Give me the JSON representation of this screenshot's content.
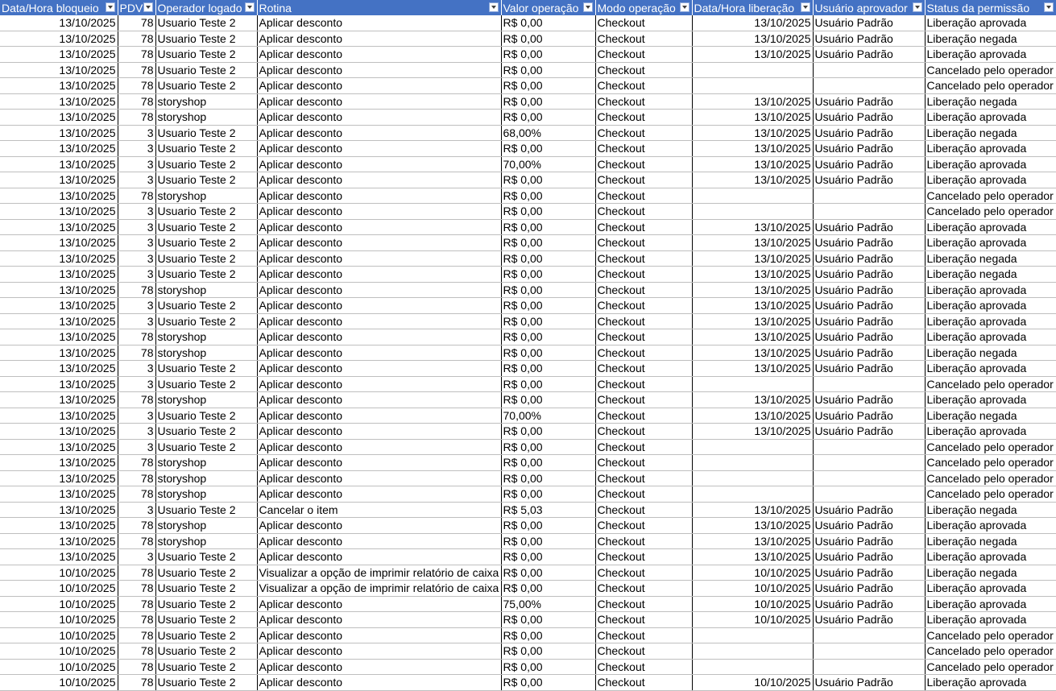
{
  "columns": [
    "Data/Hora bloqueio",
    "PDV",
    "Operador logado",
    "Rotina",
    "Valor operação",
    "Modo operação",
    "Data/Hora liberação",
    "Usuário aprovador",
    "Status da permissão"
  ],
  "rows": [
    [
      "13/10/2025",
      "78",
      "Usuario Teste 2",
      "Aplicar desconto",
      "R$ 0,00",
      "Checkout",
      "13/10/2025",
      "Usuário Padrão",
      "Liberação aprovada"
    ],
    [
      "13/10/2025",
      "78",
      "Usuario Teste 2",
      "Aplicar desconto",
      "R$ 0,00",
      "Checkout",
      "13/10/2025",
      "Usuário Padrão",
      "Liberação negada"
    ],
    [
      "13/10/2025",
      "78",
      "Usuario Teste 2",
      "Aplicar desconto",
      "R$ 0,00",
      "Checkout",
      "13/10/2025",
      "Usuário Padrão",
      "Liberação aprovada"
    ],
    [
      "13/10/2025",
      "78",
      "Usuario Teste 2",
      "Aplicar desconto",
      "R$ 0,00",
      "Checkout",
      "",
      "",
      "Cancelado pelo operador"
    ],
    [
      "13/10/2025",
      "78",
      "Usuario Teste 2",
      "Aplicar desconto",
      "R$ 0,00",
      "Checkout",
      "",
      "",
      "Cancelado pelo operador"
    ],
    [
      "13/10/2025",
      "78",
      "storyshop",
      "Aplicar desconto",
      "R$ 0,00",
      "Checkout",
      "13/10/2025",
      "Usuário Padrão",
      "Liberação negada"
    ],
    [
      "13/10/2025",
      "78",
      "storyshop",
      "Aplicar desconto",
      "R$ 0,00",
      "Checkout",
      "13/10/2025",
      "Usuário Padrão",
      "Liberação aprovada"
    ],
    [
      "13/10/2025",
      "3",
      "Usuario Teste 2",
      "Aplicar desconto",
      "68,00%",
      "Checkout",
      "13/10/2025",
      "Usuário Padrão",
      "Liberação negada"
    ],
    [
      "13/10/2025",
      "3",
      "Usuario Teste 2",
      "Aplicar desconto",
      "R$ 0,00",
      "Checkout",
      "13/10/2025",
      "Usuário Padrão",
      "Liberação aprovada"
    ],
    [
      "13/10/2025",
      "3",
      "Usuario Teste 2",
      "Aplicar desconto",
      "70,00%",
      "Checkout",
      "13/10/2025",
      "Usuário Padrão",
      "Liberação aprovada"
    ],
    [
      "13/10/2025",
      "3",
      "Usuario Teste 2",
      "Aplicar desconto",
      "R$ 0,00",
      "Checkout",
      "13/10/2025",
      "Usuário Padrão",
      "Liberação aprovada"
    ],
    [
      "13/10/2025",
      "78",
      "storyshop",
      "Aplicar desconto",
      "R$ 0,00",
      "Checkout",
      "",
      "",
      "Cancelado pelo operador"
    ],
    [
      "13/10/2025",
      "3",
      "Usuario Teste 2",
      "Aplicar desconto",
      "R$ 0,00",
      "Checkout",
      "",
      "",
      "Cancelado pelo operador"
    ],
    [
      "13/10/2025",
      "3",
      "Usuario Teste 2",
      "Aplicar desconto",
      "R$ 0,00",
      "Checkout",
      "13/10/2025",
      "Usuário Padrão",
      "Liberação aprovada"
    ],
    [
      "13/10/2025",
      "3",
      "Usuario Teste 2",
      "Aplicar desconto",
      "R$ 0,00",
      "Checkout",
      "13/10/2025",
      "Usuário Padrão",
      "Liberação aprovada"
    ],
    [
      "13/10/2025",
      "3",
      "Usuario Teste 2",
      "Aplicar desconto",
      "R$ 0,00",
      "Checkout",
      "13/10/2025",
      "Usuário Padrão",
      "Liberação negada"
    ],
    [
      "13/10/2025",
      "3",
      "Usuario Teste 2",
      "Aplicar desconto",
      "R$ 0,00",
      "Checkout",
      "13/10/2025",
      "Usuário Padrão",
      "Liberação negada"
    ],
    [
      "13/10/2025",
      "78",
      "storyshop",
      "Aplicar desconto",
      "R$ 0,00",
      "Checkout",
      "13/10/2025",
      "Usuário Padrão",
      "Liberação aprovada"
    ],
    [
      "13/10/2025",
      "3",
      "Usuario Teste 2",
      "Aplicar desconto",
      "R$ 0,00",
      "Checkout",
      "13/10/2025",
      "Usuário Padrão",
      "Liberação aprovada"
    ],
    [
      "13/10/2025",
      "3",
      "Usuario Teste 2",
      "Aplicar desconto",
      "R$ 0,00",
      "Checkout",
      "13/10/2025",
      "Usuário Padrão",
      "Liberação aprovada"
    ],
    [
      "13/10/2025",
      "78",
      "storyshop",
      "Aplicar desconto",
      "R$ 0,00",
      "Checkout",
      "13/10/2025",
      "Usuário Padrão",
      "Liberação aprovada"
    ],
    [
      "13/10/2025",
      "78",
      "storyshop",
      "Aplicar desconto",
      "R$ 0,00",
      "Checkout",
      "13/10/2025",
      "Usuário Padrão",
      "Liberação negada"
    ],
    [
      "13/10/2025",
      "3",
      "Usuario Teste 2",
      "Aplicar desconto",
      "R$ 0,00",
      "Checkout",
      "13/10/2025",
      "Usuário Padrão",
      "Liberação aprovada"
    ],
    [
      "13/10/2025",
      "3",
      "Usuario Teste 2",
      "Aplicar desconto",
      "R$ 0,00",
      "Checkout",
      "",
      "",
      "Cancelado pelo operador"
    ],
    [
      "13/10/2025",
      "78",
      "storyshop",
      "Aplicar desconto",
      "R$ 0,00",
      "Checkout",
      "13/10/2025",
      "Usuário Padrão",
      "Liberação aprovada"
    ],
    [
      "13/10/2025",
      "3",
      "Usuario Teste 2",
      "Aplicar desconto",
      "70,00%",
      "Checkout",
      "13/10/2025",
      "Usuário Padrão",
      "Liberação negada"
    ],
    [
      "13/10/2025",
      "3",
      "Usuario Teste 2",
      "Aplicar desconto",
      "R$ 0,00",
      "Checkout",
      "13/10/2025",
      "Usuário Padrão",
      "Liberação aprovada"
    ],
    [
      "13/10/2025",
      "3",
      "Usuario Teste 2",
      "Aplicar desconto",
      "R$ 0,00",
      "Checkout",
      "",
      "",
      "Cancelado pelo operador"
    ],
    [
      "13/10/2025",
      "78",
      "storyshop",
      "Aplicar desconto",
      "R$ 0,00",
      "Checkout",
      "",
      "",
      "Cancelado pelo operador"
    ],
    [
      "13/10/2025",
      "78",
      "storyshop",
      "Aplicar desconto",
      "R$ 0,00",
      "Checkout",
      "",
      "",
      "Cancelado pelo operador"
    ],
    [
      "13/10/2025",
      "78",
      "storyshop",
      "Aplicar desconto",
      "R$ 0,00",
      "Checkout",
      "",
      "",
      "Cancelado pelo operador"
    ],
    [
      "13/10/2025",
      "3",
      "Usuario Teste 2",
      "Cancelar o item",
      "R$ 5,03",
      "Checkout",
      "13/10/2025",
      "Usuário Padrão",
      "Liberação negada"
    ],
    [
      "13/10/2025",
      "78",
      "storyshop",
      "Aplicar desconto",
      "R$ 0,00",
      "Checkout",
      "13/10/2025",
      "Usuário Padrão",
      "Liberação aprovada"
    ],
    [
      "13/10/2025",
      "78",
      "storyshop",
      "Aplicar desconto",
      "R$ 0,00",
      "Checkout",
      "13/10/2025",
      "Usuário Padrão",
      "Liberação negada"
    ],
    [
      "13/10/2025",
      "3",
      "Usuario Teste 2",
      "Aplicar desconto",
      "R$ 0,00",
      "Checkout",
      "13/10/2025",
      "Usuário Padrão",
      "Liberação aprovada"
    ],
    [
      "10/10/2025",
      "78",
      "Usuario Teste 2",
      "Visualizar a opção de imprimir relatório de caixa",
      "R$ 0,00",
      "Checkout",
      "10/10/2025",
      "Usuário Padrão",
      "Liberação negada"
    ],
    [
      "10/10/2025",
      "78",
      "Usuario Teste 2",
      "Visualizar a opção de imprimir relatório de caixa",
      "R$ 0,00",
      "Checkout",
      "10/10/2025",
      "Usuário Padrão",
      "Liberação aprovada"
    ],
    [
      "10/10/2025",
      "78",
      "Usuario Teste 2",
      "Aplicar desconto",
      "75,00%",
      "Checkout",
      "10/10/2025",
      "Usuário Padrão",
      "Liberação aprovada"
    ],
    [
      "10/10/2025",
      "78",
      "Usuario Teste 2",
      "Aplicar desconto",
      "R$ 0,00",
      "Checkout",
      "10/10/2025",
      "Usuário Padrão",
      "Liberação aprovada"
    ],
    [
      "10/10/2025",
      "78",
      "Usuario Teste 2",
      "Aplicar desconto",
      "R$ 0,00",
      "Checkout",
      "",
      "",
      "Cancelado pelo operador"
    ],
    [
      "10/10/2025",
      "78",
      "Usuario Teste 2",
      "Aplicar desconto",
      "R$ 0,00",
      "Checkout",
      "",
      "",
      "Cancelado pelo operador"
    ],
    [
      "10/10/2025",
      "78",
      "Usuario Teste 2",
      "Aplicar desconto",
      "R$ 0,00",
      "Checkout",
      "",
      "",
      "Cancelado pelo operador"
    ],
    [
      "10/10/2025",
      "78",
      "Usuario Teste 2",
      "Aplicar desconto",
      "R$ 0,00",
      "Checkout",
      "10/10/2025",
      "Usuário Padrão",
      "Liberação aprovada"
    ]
  ],
  "header_color": "#4472c4"
}
